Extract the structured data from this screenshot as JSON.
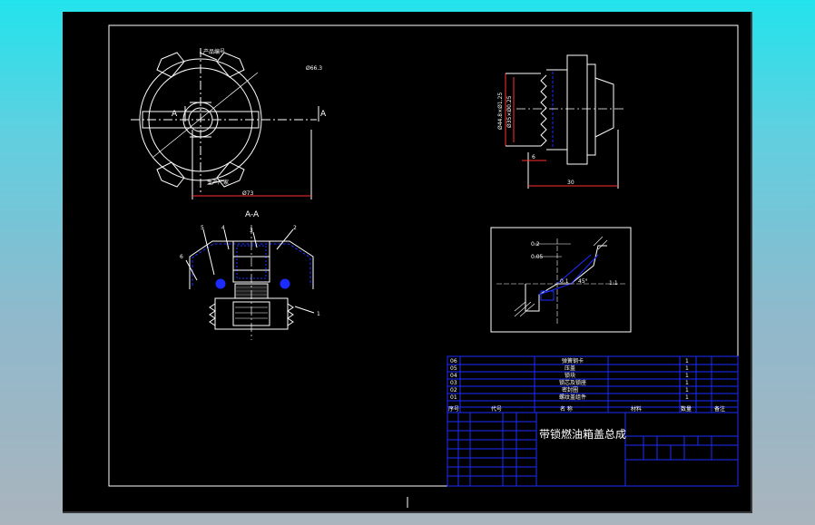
{
  "drawing": {
    "top_view": {
      "label_product_no": "产品编号",
      "label_diameter": "Ø66.3",
      "label_manufacturer": "生产厂家",
      "label_width": "Ø73",
      "section_left": "A",
      "section_right": "A"
    },
    "section_view": {
      "title": "A-A",
      "balloons": [
        "5",
        "4",
        "3",
        "2",
        "6",
        "1"
      ]
    },
    "side_view": {
      "dim_1": "Ø44.8×Ø1.25",
      "dim_2": "Ø35×Ø0.25",
      "dim_bottom": "30",
      "dim_small": "6"
    },
    "detail_view": {
      "labels": [
        "0.2",
        "0.05",
        "45°",
        "0.1",
        "1:1"
      ]
    },
    "parts_list": {
      "rows": [
        {
          "no": "06",
          "name": "弹簧钢卡",
          "qty": "1"
        },
        {
          "no": "05",
          "name": "压盖",
          "qty": "1"
        },
        {
          "no": "04",
          "name": "锁块",
          "qty": "1"
        },
        {
          "no": "03",
          "name": "锁芯及锁座",
          "qty": "1"
        },
        {
          "no": "02",
          "name": "密封圈",
          "qty": "1"
        },
        {
          "no": "01",
          "name": "螺纹盖组件",
          "qty": "1"
        }
      ],
      "header": {
        "no": "序号",
        "code": "代号",
        "name": "名 称",
        "qty": "数量",
        "material": "材料",
        "note": "备注"
      }
    },
    "title_block": {
      "title": "带锁燃油箱盖总成"
    }
  }
}
